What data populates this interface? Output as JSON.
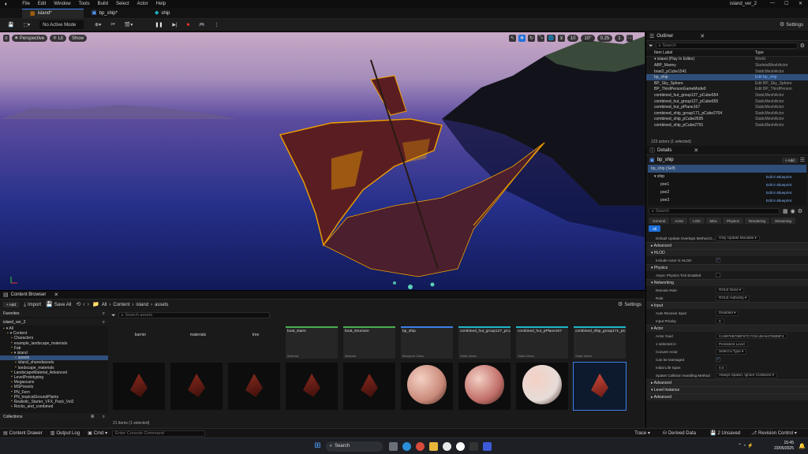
{
  "app": {
    "menu": [
      "File",
      "Edit",
      "Window",
      "Tools",
      "Build",
      "Select",
      "Actor",
      "Help"
    ],
    "project_name": "island_ver_2",
    "window_controls": [
      "—",
      "☐",
      "✕"
    ]
  },
  "tabs": [
    {
      "label": "island*",
      "active": true
    },
    {
      "label": "bp_ship*",
      "active": false
    },
    {
      "label": "ship",
      "active": false
    }
  ],
  "toolbar": {
    "mode": "No Active Mode",
    "settings_label": "Settings"
  },
  "viewport": {
    "perspective_label": "Perspective",
    "lit_label": "Lit",
    "show_label": "Show",
    "grid_snap": "10",
    "angle_snap": "10°",
    "scale_snap": "0.25",
    "camera_speed": "1"
  },
  "outliner": {
    "title": "Outliner",
    "search_placeholder": "Search",
    "col_label": "Item Label",
    "col_type": "Type",
    "rows": [
      {
        "label": "▾ island (Play In Editor)",
        "type": "World",
        "sel": false
      },
      {
        "label": "ABP_Manny",
        "type": "SkeletalMeshActor",
        "sel": false
      },
      {
        "label": "boat2_pCube1541",
        "type": "StaticMeshActor",
        "sel": false
      },
      {
        "label": "bp_ship",
        "type": "Edit bp_ship",
        "sel": true
      },
      {
        "label": "BP_Sky_Sphere",
        "type": "Edit BP_Sky_Sphere",
        "sel": false
      },
      {
        "label": "BP_ThirdPersonGameMode0",
        "type": "Edit BP_ThirdPerson",
        "sel": false
      },
      {
        "label": "combined_hut_group127_pCube654",
        "type": "StaticMeshActor",
        "sel": false
      },
      {
        "label": "combined_hut_group127_pCube655",
        "type": "StaticMeshActor",
        "sel": false
      },
      {
        "label": "combined_hut_pPlane167",
        "type": "StaticMeshActor",
        "sel": false
      },
      {
        "label": "combined_ship_group171_pCube2704",
        "type": "StaticMeshActor",
        "sel": false
      },
      {
        "label": "combined_ship_pCube2695",
        "type": "StaticMeshActor",
        "sel": false
      },
      {
        "label": "combined_ship_pCube2791",
        "type": "StaticMeshActor",
        "sel": false
      }
    ],
    "footer": "123 actors (1 selected)"
  },
  "details": {
    "title": "Details",
    "actor_name": "bp_ship",
    "add_label": "+ Add",
    "components": [
      {
        "label": "bp_ship (Self)",
        "link": "",
        "sel": true
      },
      {
        "label": "▾ ship",
        "link": "Edit in Blueprint",
        "sel": false
      },
      {
        "label": "poe1",
        "link": "Edit in Blueprint",
        "sel": false
      },
      {
        "label": "poe2",
        "link": "Edit in Blueprint",
        "sel": false
      },
      {
        "label": "poe3",
        "link": "Edit in Blueprint",
        "sel": false
      }
    ],
    "search_placeholder": "Search",
    "category_tabs": [
      "General",
      "Actor",
      "LOD",
      "Misc",
      "Physics",
      "Rendering",
      "Streaming",
      "All"
    ],
    "sections": [
      {
        "type": "prop",
        "key": "Default Update Overlaps Method D...",
        "value": "Only Update Movable ▾"
      },
      {
        "type": "sec",
        "label": "▸ Advanced"
      },
      {
        "type": "sec",
        "label": "▾ HLOD"
      },
      {
        "type": "prop",
        "key": "Include Actor in HLOD",
        "check": true
      },
      {
        "type": "sec",
        "label": "▾ Physics"
      },
      {
        "type": "prop",
        "key": "Async Physics Tick Enabled",
        "check": false
      },
      {
        "type": "sec",
        "label": "▾ Networking"
      },
      {
        "type": "prop",
        "key": "Remote Role",
        "value": "ROLE None ▾"
      },
      {
        "type": "prop",
        "key": "Role",
        "value": "ROLE Authority ▾"
      },
      {
        "type": "sec",
        "label": "▾ Input"
      },
      {
        "type": "prop",
        "key": "Auto Receive Input",
        "value": "Disabled ▾"
      },
      {
        "type": "prop",
        "key": "Input Priority",
        "value": "0"
      },
      {
        "type": "sec",
        "label": "▾ Actor"
      },
      {
        "type": "prop",
        "key": "Actor Guid",
        "value": "CA8976B76BF97C7C8A48A64756B8F4"
      },
      {
        "type": "prop",
        "key": "1 selected in",
        "value": "Persistent Level"
      },
      {
        "type": "prop",
        "key": "Convert Actor",
        "value": "Select a Type ▾"
      },
      {
        "type": "prop",
        "key": "Can be Damaged",
        "check": true
      },
      {
        "type": "prop",
        "key": "Initial Life Span",
        "value": "0.0"
      },
      {
        "type": "prop",
        "key": "Spawn Collision Handling Method",
        "value": "Always Spawn, Ignore Collisions ▾"
      },
      {
        "type": "sec",
        "label": "▸ Advanced"
      },
      {
        "type": "sec",
        "label": "▾ Level Instance"
      },
      {
        "type": "sec",
        "label": "▸ Advanced"
      }
    ]
  },
  "content_browser": {
    "title": "Content Browser",
    "add_label": "+ Add",
    "import_label": "Import",
    "save_all_label": "Save All",
    "breadcrumb": [
      "All",
      "Content",
      "island",
      "assets"
    ],
    "settings_label": "Settings",
    "favorites_label": "Favorites",
    "project_label": "island_ver_2",
    "search_placeholder": "Search assets",
    "tree": [
      {
        "label": "▾ All",
        "indent": 0,
        "sel": false
      },
      {
        "label": "▾ Content",
        "indent": 1,
        "sel": false
      },
      {
        "label": "Characters",
        "indent": 2,
        "sel": false
      },
      {
        "label": "example_landscape_materials",
        "indent": 2,
        "sel": false
      },
      {
        "label": "Fab",
        "indent": 2,
        "sel": false
      },
      {
        "label": "▾ island",
        "indent": 2,
        "sel": false
      },
      {
        "label": "assets",
        "indent": 3,
        "sel": true
      },
      {
        "label": "island_sharedassets",
        "indent": 3,
        "sel": false
      },
      {
        "label": "landscape_materials",
        "indent": 3,
        "sel": false
      },
      {
        "label": "LandscapeMaterial_Advanced",
        "indent": 2,
        "sel": false
      },
      {
        "label": "LevelPrototyping",
        "indent": 2,
        "sel": false
      },
      {
        "label": "Megascans",
        "indent": 2,
        "sel": false
      },
      {
        "label": "MSPresets",
        "indent": 2,
        "sel": false
      },
      {
        "label": "PN_Fern",
        "indent": 2,
        "sel": false
      },
      {
        "label": "PN_tropicalGroundPlants",
        "indent": 2,
        "sel": false
      },
      {
        "label": "Realistic_Starter_VFX_Pack_Vol2",
        "indent": 2,
        "sel": false
      },
      {
        "label": "Rocks_and_combined",
        "indent": 2,
        "sel": false
      }
    ],
    "folders": [
      "barrier",
      "materials",
      "tree"
    ],
    "assets_row1": [
      {
        "name": "boat_stairs",
        "kind": "Material",
        "color": "#4caf50"
      },
      {
        "name": "boat_structure",
        "kind": "Material",
        "color": "#4caf50"
      },
      {
        "name": "bp_ship",
        "kind": "Blueprint Class",
        "color": "#3d7ee8"
      },
      {
        "name": "combined_hut_group127_pCube654",
        "kind": "Static Mesh",
        "color": "#1fb6c9"
      },
      {
        "name": "combined_hut_pPlane167",
        "kind": "Static Mesh",
        "color": "#1fb6c9"
      },
      {
        "name": "combined_ship_group171_pCube2704",
        "kind": "Static Mesh",
        "color": "#1fb6c9"
      }
    ],
    "collections_label": "Collections",
    "status": "21 items (1 selected)"
  },
  "statusbar": {
    "content_drawer": "Content Drawer",
    "output_log": "Output Log",
    "cmd": "Cmd ▾",
    "console_placeholder": "Enter Console Command",
    "trace": "Trace ▾",
    "derived_data": "Derived Data",
    "unsaved": "2 Unsaved",
    "revision_control": "Revision Control ▾"
  },
  "taskbar": {
    "search_placeholder": "Search",
    "time": "15:45",
    "date": "23/05/2025"
  },
  "colors": {
    "selection": "#2f4f7a",
    "accent": "#3d7ee8",
    "ship_outline": "#f0a000"
  }
}
